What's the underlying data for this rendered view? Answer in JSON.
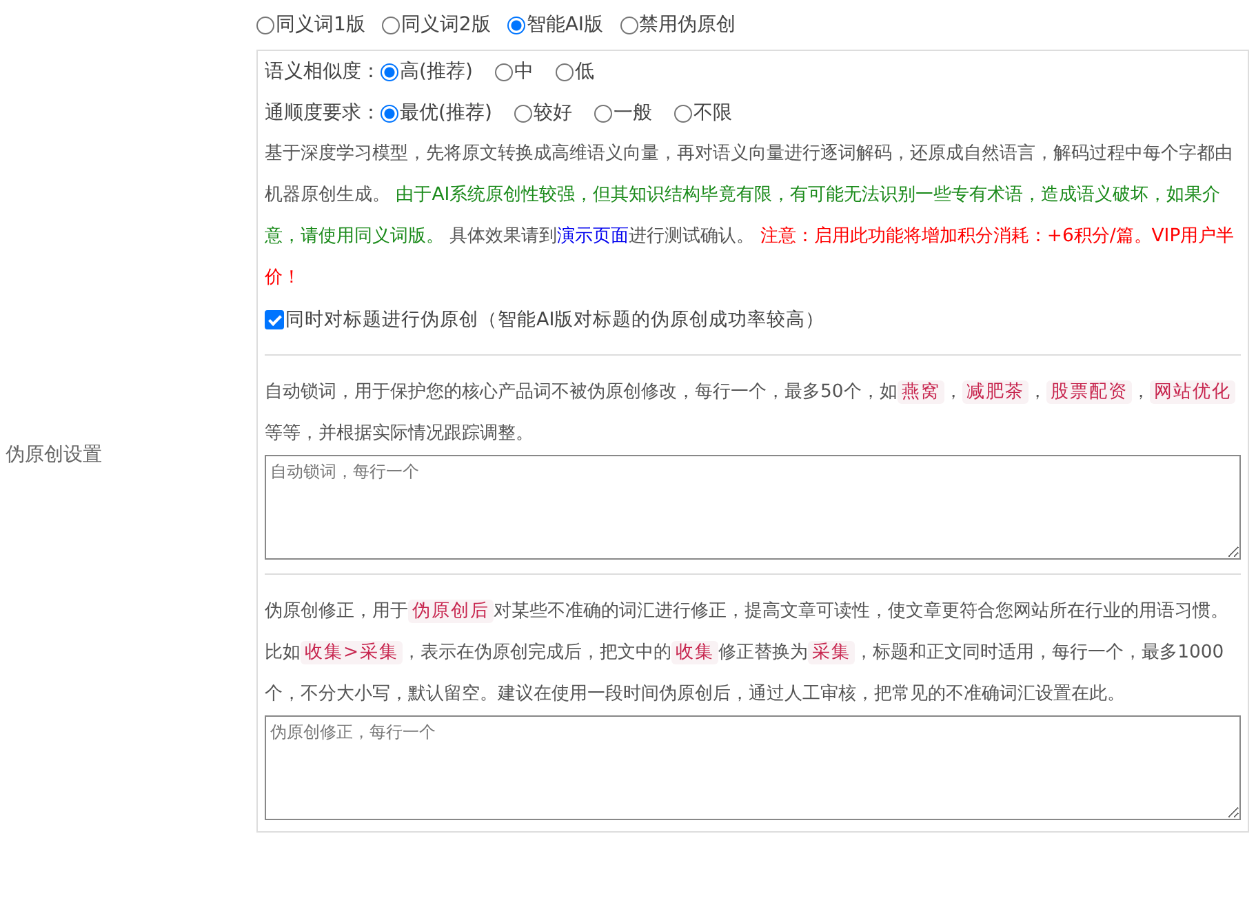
{
  "section_label": "伪原创设置",
  "modes": [
    {
      "label": "同义词1版",
      "selected": false
    },
    {
      "label": "同义词2版",
      "selected": false
    },
    {
      "label": "智能AI版",
      "selected": true
    },
    {
      "label": "禁用伪原创",
      "selected": false
    }
  ],
  "option_groups": [
    {
      "label": "语义相似度：",
      "options": [
        {
          "label": "高(推荐)",
          "selected": true
        },
        {
          "label": "中",
          "selected": false
        },
        {
          "label": "低",
          "selected": false
        }
      ]
    },
    {
      "label": "通顺度要求：",
      "options": [
        {
          "label": "最优(推荐)",
          "selected": true
        },
        {
          "label": "较好",
          "selected": false
        },
        {
          "label": "一般",
          "selected": false
        },
        {
          "label": "不限",
          "selected": false
        }
      ]
    }
  ],
  "description": [
    {
      "kind": "text",
      "text": "基于深度学习模型，先将原文转换成高维语义向量，再对语义向量进行逐词解码，还原成自然语言，解码过程中每个字都由机器原创生成。 "
    },
    {
      "kind": "green",
      "text": "由于AI系统原创性较强，但其知识结构毕竟有限，有可能无法识别一些专有术语，造成语义破坏，如果介意，请使用同义词版。"
    },
    {
      "kind": "text",
      "text": " 具体效果请到"
    },
    {
      "kind": "link",
      "text": "演示页面"
    },
    {
      "kind": "text",
      "text": "进行测试确认。 "
    },
    {
      "kind": "red",
      "text": "注意：启用此功能将增加积分消耗：+6积分/篇。VIP用户半价！"
    }
  ],
  "title_option": {
    "label": "同时对标题进行伪原创（智能AI版对标题的伪原创成功率较高）",
    "checked": true
  },
  "sections": [
    {
      "description": [
        {
          "kind": "text",
          "text": "自动锁词，用于保护您的核心产品词不被伪原创修改，每行一个，最多50个，如"
        },
        {
          "kind": "code",
          "text": "燕窝"
        },
        {
          "kind": "text",
          "text": "，"
        },
        {
          "kind": "code",
          "text": "减肥茶"
        },
        {
          "kind": "text",
          "text": "，"
        },
        {
          "kind": "code",
          "text": "股票配资"
        },
        {
          "kind": "text",
          "text": "，"
        },
        {
          "kind": "code",
          "text": "网站优化"
        },
        {
          "kind": "text",
          "text": "等等，并根据实际情况跟踪调整。"
        }
      ],
      "placeholder": "自动锁词，每行一个"
    },
    {
      "description": [
        {
          "kind": "text",
          "text": "伪原创修正，用于"
        },
        {
          "kind": "code",
          "text": "伪原创后"
        },
        {
          "kind": "text",
          "text": "对某些不准确的词汇进行修正，提高文章可读性，使文章更符合您网站所在行业的用语习惯。比如"
        },
        {
          "kind": "code",
          "text": "收集>采集"
        },
        {
          "kind": "text",
          "text": "，表示在伪原创完成后，把文中的"
        },
        {
          "kind": "code",
          "text": "收集"
        },
        {
          "kind": "text",
          "text": "修正替换为"
        },
        {
          "kind": "code",
          "text": "采集"
        },
        {
          "kind": "text",
          "text": "，标题和正文同时适用，每行一个，最多1000个，不分大小写，默认留空。建议在使用一段时间伪原创后，通过人工审核，把常见的不准确词汇设置在此。"
        }
      ],
      "placeholder": "伪原创修正，每行一个"
    }
  ]
}
